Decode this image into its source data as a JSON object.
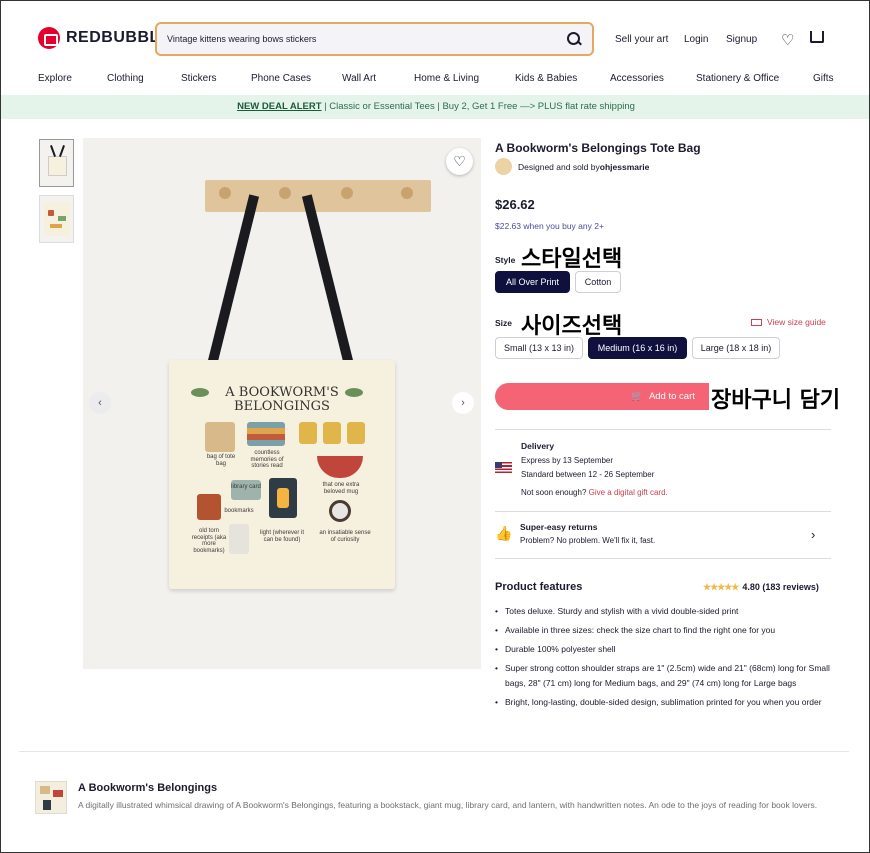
{
  "header": {
    "logo": "REDBUBBLE",
    "search_value": "Vintage kittens wearing bows stickers",
    "links": [
      "Sell your art",
      "Login",
      "Signup"
    ],
    "heart_icon": "heart-icon",
    "cart_icon": "cart-icon"
  },
  "nav": [
    "Explore",
    "Clothing",
    "Stickers",
    "Phone Cases",
    "Wall Art",
    "Home & Living",
    "Kids & Babies",
    "Accessories",
    "Stationery & Office",
    "Gifts"
  ],
  "banner": {
    "link": "NEW DEAL ALERT",
    "text": " | Classic or Essential Tees | Buy 2, Get 1 Free —> PLUS flat rate shipping"
  },
  "product": {
    "title": "A Bookworm's Belongings Tote Bag",
    "seller_prefix": "Designed and sold by ",
    "seller_name": "ohjessmarie",
    "price": "$26.62",
    "bulk_price": "$22.63 when you buy any 2+",
    "style_label": "Style",
    "style_annotation": "스타일선택",
    "styles": [
      "All Over Print",
      "Cotton"
    ],
    "size_label": "Size",
    "size_annotation": "사이즈선택",
    "size_guide": "View size guide",
    "sizes": [
      "Small (13 x 13 in)",
      "Medium (16 x 16 in)",
      "Large (18 x 18 in)"
    ],
    "add_to_cart": "Add to cart",
    "cart_annotation": "장바구니 담기",
    "delivery": {
      "title": "Delivery",
      "express": "Express by 13 September",
      "standard": "Standard between 12 - 26 September",
      "not_soon": "Not soon enough? ",
      "gift_link": "Give a digital gift card."
    },
    "returns": {
      "title": "Super-easy returns",
      "text": "Problem? No problem. We'll fix it, fast."
    },
    "features_title": "Product features",
    "rating": "4.80 (183 reviews)",
    "stars": "★★★★★",
    "features": [
      "Totes deluxe. Sturdy and stylish with a vivid double-sided print",
      "Available in three sizes: check the size chart to find the right one for you",
      "Durable 100% polyester shell",
      "Super strong cotton shoulder straps are 1\" (2.5cm) wide and 21\" (68cm) long for Small bags, 28\" (71 cm) long for Medium bags, and 29\" (74 cm) long for Large bags",
      "Bright, long-lasting, double-sided design, sublimation printed for you when you order"
    ]
  },
  "artwork": {
    "title_line1": "A BOOKWORM'S",
    "title_line2": "BELONGINGS",
    "labels": {
      "bag": "bag of tote bag",
      "memories": "countless memories of stories read",
      "mug": "that one extra beloved mug",
      "library": "library card",
      "bookmarks": "bookmarks",
      "receipts": "old torn receipts (aka more bookmarks)",
      "light": "light (wherever it can be found)",
      "curiosity": "an insatiable sense of curiosity"
    }
  },
  "design": {
    "title": "A Bookworm's Belongings",
    "description": "A digitally illustrated whimsical drawing of A Bookworm's Belongings, featuring a bookstack, giant mug, library card, and lantern, with handwritten notes. An ode to the joys of reading for book lovers."
  },
  "colors": {
    "brand": "#e4002b",
    "selected": "#10103e",
    "cart": "#f46475",
    "banner_bg": "#e4f4ea"
  }
}
